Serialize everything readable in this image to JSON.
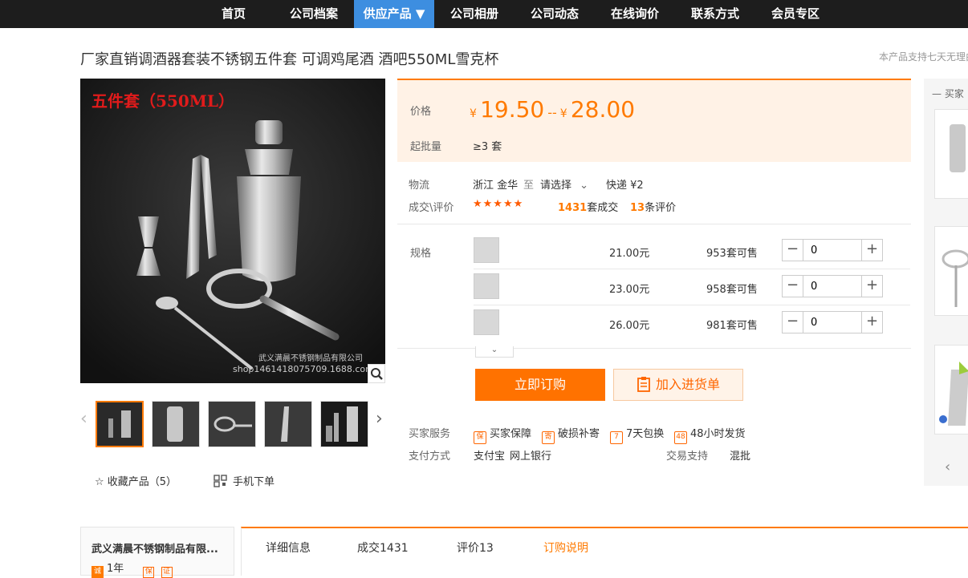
{
  "nav": {
    "items": [
      "首页",
      "公司档案",
      "供应产品 ▼",
      "公司相册",
      "公司动态",
      "在线询价",
      "联系方式",
      "会员专区"
    ],
    "active_index": 2
  },
  "product": {
    "title": "厂家直销调酒器套装不锈钢五件套 可调鸡尾酒 酒吧550ML雪克杯",
    "notice": "本产品支持七天无理由",
    "image_badge": "五件套（550ML）",
    "watermark_company": "武义满晨不锈钢制品有限公司",
    "watermark_shop": "shop1461418075709.1688.com"
  },
  "price": {
    "label": "价格",
    "currency": "¥",
    "low": "19.50",
    "separator": "--",
    "high": "28.00",
    "moq_label": "起批量",
    "moq_value": "≥3 套"
  },
  "logistics": {
    "label": "物流",
    "origin": "浙江 金华",
    "to": "至",
    "select": "请选择",
    "express": "快递 ¥2"
  },
  "trade": {
    "label": "成交\\评价",
    "stars": "★★★★★",
    "deals_num": "1431",
    "deals_unit": "套成交",
    "reviews_num": "13",
    "reviews_unit": "条评价"
  },
  "spec": {
    "label": "规格",
    "rows": [
      {
        "price": "21.00元",
        "stock": "953套可售",
        "qty": "0"
      },
      {
        "price": "23.00元",
        "stock": "958套可售",
        "qty": "0"
      },
      {
        "price": "26.00元",
        "stock": "981套可售",
        "qty": "0"
      }
    ],
    "minus": "−",
    "plus": "+",
    "expand": "⌄"
  },
  "actions": {
    "buy": "立即订购",
    "cart": "加入进货单"
  },
  "services": {
    "label": "买家服务",
    "items": [
      "买家保障",
      "破损补寄",
      "7天包换",
      "48小时发货"
    ],
    "icons": [
      "保",
      "寄",
      "7",
      "48"
    ],
    "pay_label": "支付方式",
    "pay_items": [
      "支付宝",
      "网上银行"
    ],
    "trade_label": "交易支持",
    "trade_value": "混批"
  },
  "gallery": {
    "fav": "☆ 收藏产品（5）",
    "mobile": "手机下单"
  },
  "sidebar": {
    "head": "买家"
  },
  "company": {
    "name": "武义满晨不锈钢制品有限...",
    "years": "1年"
  },
  "tabs": [
    "详细信息",
    "成交1431",
    "评价13",
    "订购说明"
  ],
  "active_tab": 3,
  "colors": {
    "accent": "#ff7a00",
    "nav_bg": "#1d1d1d",
    "nav_active": "#3d8ee0",
    "price_bg": "#fff2e6"
  }
}
